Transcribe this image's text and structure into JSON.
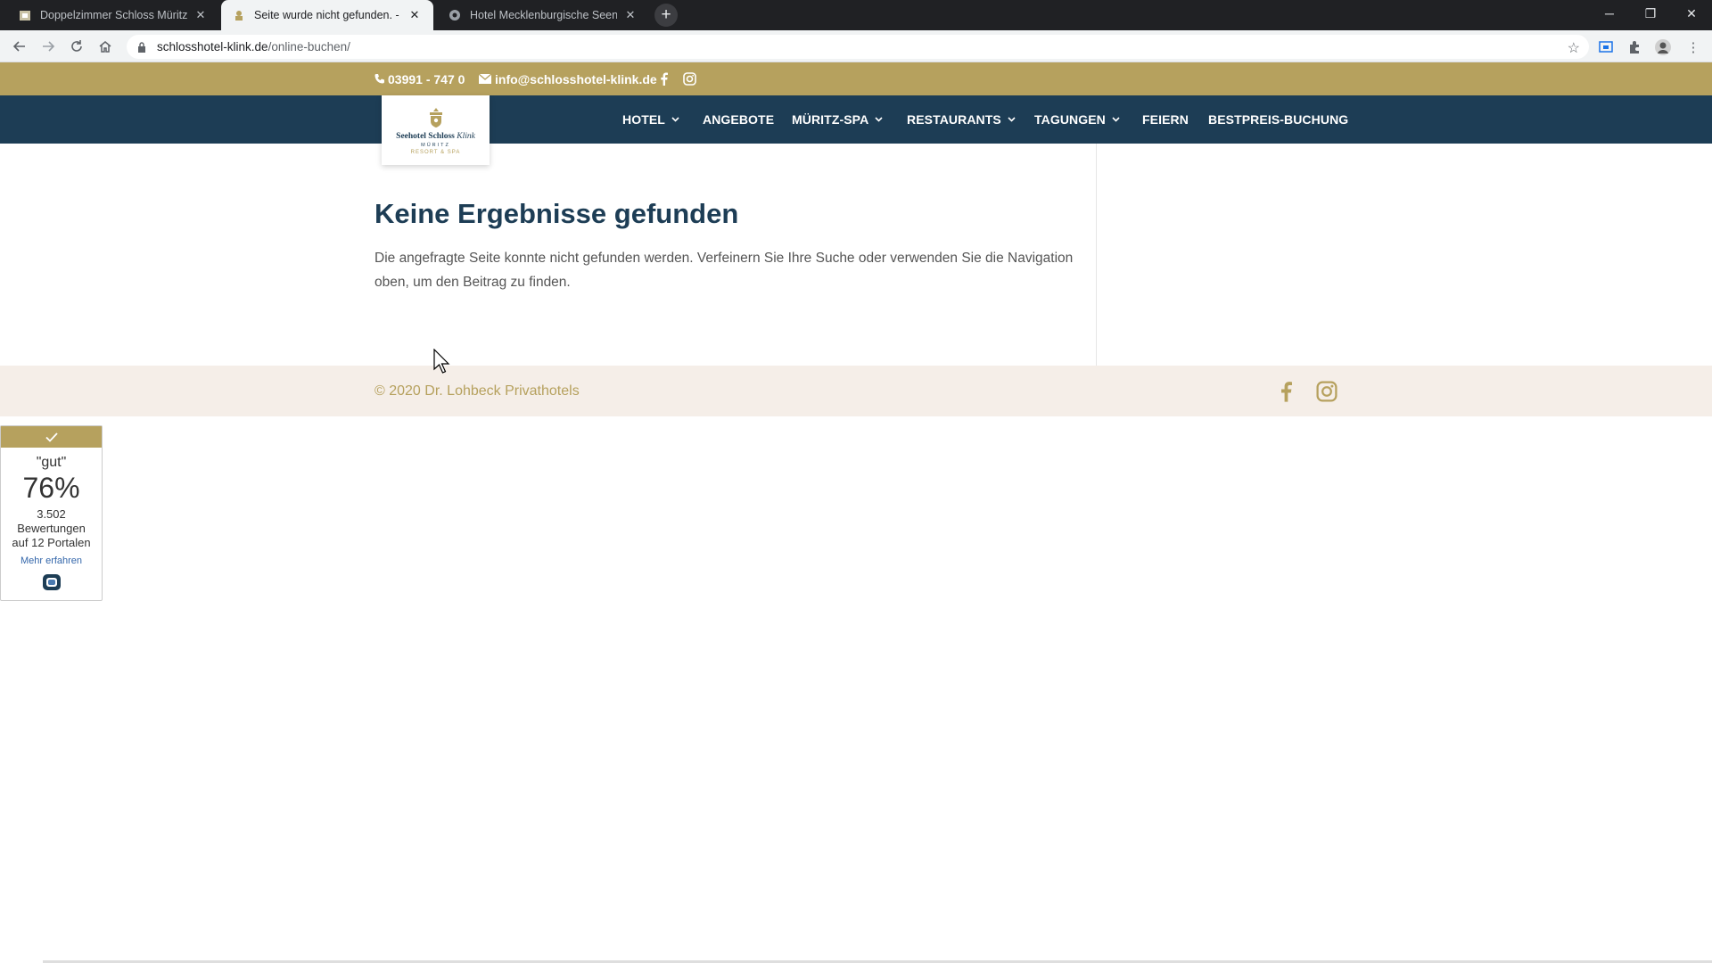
{
  "browser": {
    "tabs": [
      {
        "title": "Doppelzimmer Schloss Müritzblick",
        "active": false
      },
      {
        "title": "Seite wurde nicht gefunden. - Seehotel",
        "active": true
      },
      {
        "title": "Hotel Mecklenburgische Seenplatte",
        "active": false
      }
    ],
    "close_glyph": "✕",
    "new_tab_glyph": "+",
    "window_controls": {
      "minimize": "─",
      "restore": "❐",
      "close": "✕"
    },
    "url_host": "schlosshotel-klink.de",
    "url_path": "/online-buchen/"
  },
  "topbar": {
    "phone": "03991 - 747 0",
    "email": "info@schlosshotel-klink.de"
  },
  "logo": {
    "line1": "Seehotel Schloss",
    "line1_script": "Klink",
    "line2": "MÜRITZ",
    "line3": "RESORT & SPA"
  },
  "nav": {
    "items": [
      {
        "label": "HOTEL",
        "dropdown": true
      },
      {
        "label": "ANGEBOTE",
        "dropdown": false
      },
      {
        "label": "MÜRITZ-SPA",
        "dropdown": true
      },
      {
        "label": "RESTAURANTS",
        "dropdown": true
      },
      {
        "label": "TAGUNGEN",
        "dropdown": true
      },
      {
        "label": "FEIERN",
        "dropdown": false
      },
      {
        "label": "BESTPREIS-BUCHUNG",
        "dropdown": false
      }
    ]
  },
  "content": {
    "heading": "Keine Ergebnisse gefunden",
    "text": "Die angefragte Seite konnte nicht gefunden werden. Verfeinern Sie Ihre Suche oder verwenden Sie die Navigation oben, um den Beitrag zu finden."
  },
  "footer": {
    "copyright": "© 2020 Dr. Lohbeck Privathotels"
  },
  "review_widget": {
    "rating_label": "\"gut\"",
    "percent": "76%",
    "count": "3.502",
    "count_label": "Bewertungen",
    "portals": "auf 12 Portalen",
    "link": "Mehr erfahren"
  },
  "colors": {
    "gold": "#b6a15e",
    "navy": "#1d3d55",
    "footer_bg": "#f5eee8"
  },
  "icons": {
    "topbar": [
      "phone-icon",
      "mail-icon",
      "facebook-icon",
      "instagram-icon"
    ],
    "footer": [
      "facebook-icon",
      "instagram-icon"
    ]
  }
}
